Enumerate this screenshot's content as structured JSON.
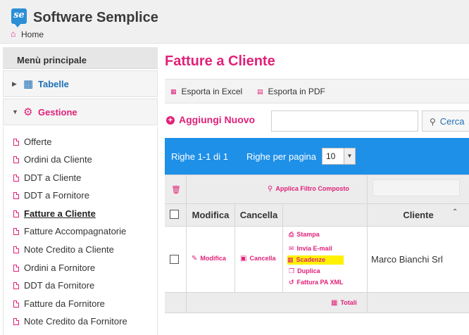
{
  "app": {
    "title": "Software Semplice",
    "logo_text": "se"
  },
  "breadcrumb": {
    "home": "Home"
  },
  "sidebar": {
    "heading": "Menù principale",
    "sections": [
      {
        "label": "Tabelle",
        "icon": "table-icon",
        "expanded": false
      },
      {
        "label": "Gestione",
        "icon": "gears-icon",
        "expanded": true
      }
    ],
    "items": [
      {
        "label": "Offerte"
      },
      {
        "label": "Ordini da Cliente"
      },
      {
        "label": "DDT a Cliente"
      },
      {
        "label": "DDT a Fornitore"
      },
      {
        "label": "Fatture a Cliente",
        "active": true
      },
      {
        "label": "Fatture Accompagnatorie"
      },
      {
        "label": "Note Credito a Cliente"
      },
      {
        "label": "Ordini a Fornitore"
      },
      {
        "label": "DDT da Fornitore"
      },
      {
        "label": "Fatture da Fornitore"
      },
      {
        "label": "Note Credito da Fornitore"
      }
    ]
  },
  "main": {
    "title": "Fatture a Cliente",
    "export": {
      "excel": "Esporta in Excel",
      "pdf": "Esporta in PDF"
    },
    "add_new": "Aggiungi Nuovo",
    "search": {
      "value": "",
      "button": "Cerca"
    },
    "pager": {
      "rows_info": "Righe 1-1 di 1",
      "per_page_label": "Righe per pagina",
      "per_page_value": "10"
    },
    "table": {
      "filter_link": "Applica Filtro Composto",
      "headers": {
        "modifica": "Modifica",
        "cancella": "Cancella",
        "cliente": "Cliente"
      },
      "row": {
        "modifica": "Modifica",
        "cancella": "Cancella",
        "actions": [
          "Stampa",
          "Invia E-mail",
          "Scadenze",
          "Duplica",
          "Fattura PA XML"
        ],
        "cliente": "Marco Bianchi Srl"
      },
      "totals_link": "Totali"
    }
  },
  "colors": {
    "accent": "#e0217a",
    "link_blue": "#1f6fb5",
    "pager_bg": "#1e90e8",
    "highlight": "#fff100"
  }
}
